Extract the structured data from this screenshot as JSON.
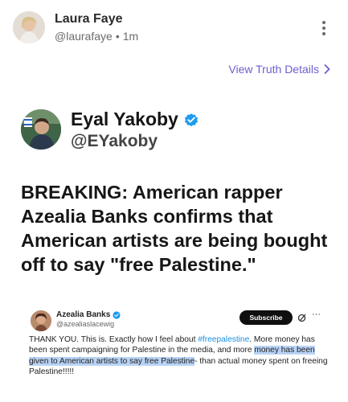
{
  "post": {
    "author_name": "Laura Faye",
    "author_handle": "@laurafaye",
    "separator": "•",
    "timestamp": "1m",
    "view_details_label": "View Truth Details"
  },
  "quoted": {
    "author_name": "Eyal Yakoby",
    "author_handle": "@EYakoby",
    "headline": "BREAKING: American rapper Azealia Banks confirms that American artists are being bought off to say \"free Palestine.\""
  },
  "embedded": {
    "author_name": "Azealia Banks",
    "author_handle": "@azealiaslacewig",
    "subscribe_label": "Subscribe",
    "more_label": "···",
    "text_part1": "THANK YOU. This is. Exactly how I feel about ",
    "hashtag": "#freepalestine",
    "text_part2": ". More money has been spent campaigning for Palestine in the media, and more ",
    "text_highlight": "money has been given to American artists to say free Palestine",
    "text_part3": "- than actual money spent on freeing Palestine!!!!!"
  },
  "colors": {
    "link": "#6c5fcf",
    "verified": "#1d9bf0",
    "hashtag": "#1d8fe0",
    "highlight": "#b9d3f5"
  },
  "icons": {
    "more": "kebab-vertical-icon",
    "chevron": "chevron-right-icon",
    "verified": "verified-badge-icon",
    "grok": "grok-icon"
  }
}
